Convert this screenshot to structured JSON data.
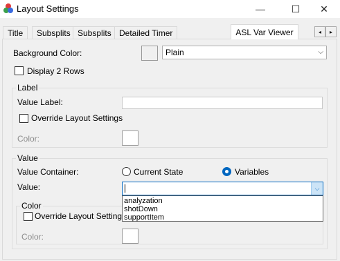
{
  "window": {
    "title": "Layout Settings",
    "minimize_glyph": "—",
    "maximize_glyph": "☐",
    "close_glyph": "✕"
  },
  "tabs": [
    {
      "label": "Title",
      "active": false
    },
    {
      "label": "Subsplits",
      "active": false
    },
    {
      "label": "Subsplits",
      "active": false
    },
    {
      "label": "Detailed Timer",
      "active": false
    },
    {
      "label": "ASL Var Viewer",
      "active": true
    }
  ],
  "tab_scroll": {
    "left_glyph": "◂",
    "right_glyph": "▸"
  },
  "background": {
    "label": "Background Color:",
    "color_swatch": "#f0f0f0",
    "selected": "Plain"
  },
  "display_2_rows": {
    "label": "Display 2 Rows",
    "checked": false
  },
  "label_group": {
    "title": "Label",
    "value_label": "Value Label:",
    "value_label_text": "",
    "override": {
      "label": "Override Layout Settings",
      "checked": false
    },
    "color_label": "Color:",
    "color_swatch": "#ffffff"
  },
  "value_group": {
    "title": "Value",
    "container_label": "Value Container:",
    "radio_current_state": {
      "label": "Current State",
      "checked": false
    },
    "radio_variables": {
      "label": "Variables",
      "checked": true
    },
    "value_label": "Value:",
    "value_text": "",
    "dropdown_options": [
      "analyzation",
      "shotDown",
      "supportItem"
    ],
    "color_subgroup": {
      "title": "Color",
      "override": {
        "label": "Override Layout Settings",
        "checked": false
      },
      "color_label": "Color:",
      "color_swatch": "#ffffff"
    }
  },
  "colors": {
    "accent": "#0067c0",
    "window_bg": "#f0f0f0",
    "dim_text": "#8c8c8c"
  }
}
